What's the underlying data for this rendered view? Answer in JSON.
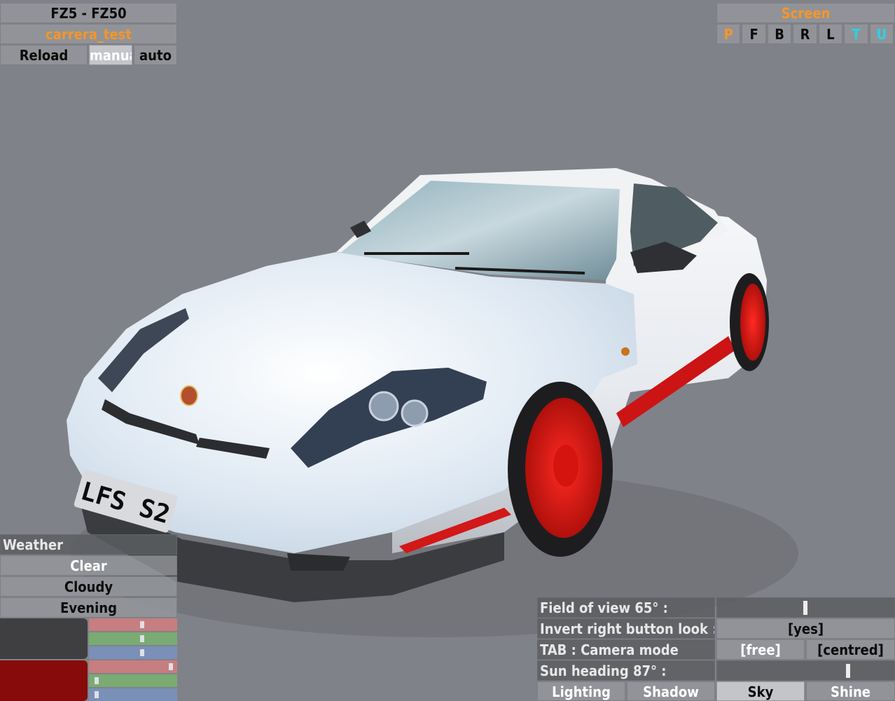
{
  "topleft": {
    "car_title": "FZ5 - FZ50",
    "skin_name": "carrera_test",
    "reload_label": "Reload",
    "manual_label": "manual",
    "auto_label": "auto"
  },
  "screen": {
    "title": "Screen",
    "views": [
      {
        "label": "P",
        "color": "orange"
      },
      {
        "label": "F",
        "color": "default"
      },
      {
        "label": "B",
        "color": "default"
      },
      {
        "label": "R",
        "color": "default"
      },
      {
        "label": "L",
        "color": "default"
      },
      {
        "label": "T",
        "color": "cyan"
      },
      {
        "label": "U",
        "color": "cyan"
      }
    ]
  },
  "weather": {
    "title": "Weather",
    "options": [
      "Clear",
      "Cloudy",
      "Evening"
    ]
  },
  "colors": {
    "swatch1": "#3f3f41",
    "swatch2": "#880b0c",
    "red_stripe": "#c67e80",
    "green_stripe": "#79ab72",
    "blue_stripe": "#7a90b8",
    "swatch1_rgb": [
      0.6,
      0.6,
      0.6
    ],
    "swatch2_rgb": [
      0.95,
      0.05,
      0.05
    ]
  },
  "plate": {
    "text": "LFS S2"
  },
  "camera_panel": {
    "fov_label": "Field of view 65° :",
    "fov_fraction": 0.5,
    "invert_label": "Invert right button look :",
    "invert_value": "[yes]",
    "tab_label": "TAB : Camera mode",
    "mode_free": "[free]",
    "mode_centred": "[centred]",
    "sun_label": "Sun heading 87° :",
    "sun_fraction": 0.75,
    "tabs": [
      "Lighting",
      "Shadow",
      "Sky",
      "Shine"
    ]
  }
}
